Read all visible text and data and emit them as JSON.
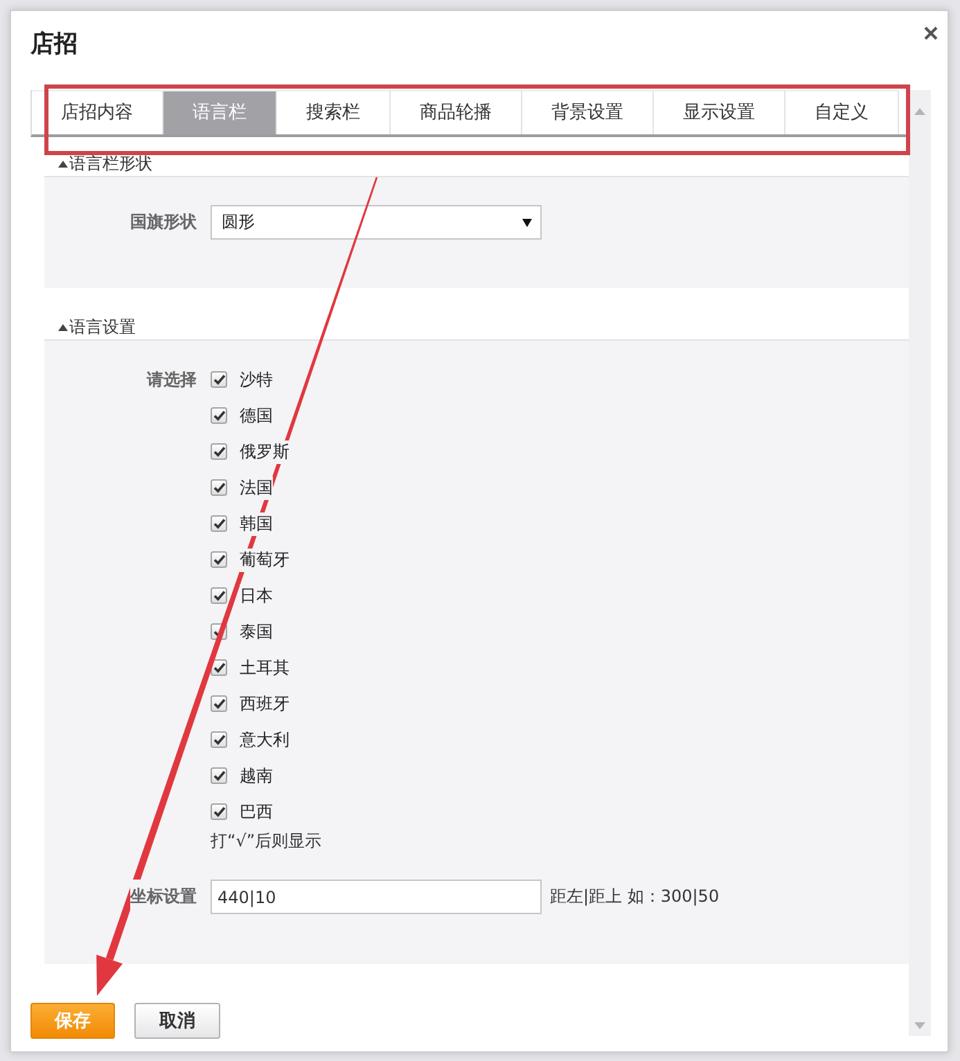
{
  "dialog": {
    "title": "店招"
  },
  "tabs": [
    {
      "label": "店招内容",
      "selected": false
    },
    {
      "label": "语言栏",
      "selected": true
    },
    {
      "label": "搜索栏",
      "selected": false
    },
    {
      "label": "商品轮播",
      "selected": false
    },
    {
      "label": "背景设置",
      "selected": false
    },
    {
      "label": "显示设置",
      "selected": false
    },
    {
      "label": "自定义",
      "selected": false
    }
  ],
  "sections": [
    {
      "title": "语言栏形状",
      "expanded": true,
      "fields": [
        {
          "kind": "select",
          "label": "国旗形状",
          "value": "圆形"
        }
      ]
    },
    {
      "title": "语言设置",
      "expanded": true,
      "fields": [
        {
          "kind": "checklist",
          "label": "请选择",
          "options": [
            {
              "label": "沙特",
              "checked": true
            },
            {
              "label": "德国",
              "checked": true
            },
            {
              "label": "俄罗斯",
              "checked": true
            },
            {
              "label": "法国",
              "checked": true
            },
            {
              "label": "韩国",
              "checked": true
            },
            {
              "label": "葡萄牙",
              "checked": true
            },
            {
              "label": "日本",
              "checked": true
            },
            {
              "label": "泰国",
              "checked": true
            },
            {
              "label": "土耳其",
              "checked": true
            },
            {
              "label": "西班牙",
              "checked": true
            },
            {
              "label": "意大利",
              "checked": true
            },
            {
              "label": "越南",
              "checked": true
            },
            {
              "label": "巴西",
              "checked": true
            }
          ],
          "note": "打“√”后则显示"
        },
        {
          "kind": "text",
          "label": "坐标设置",
          "value": "440|10",
          "hint": "距左|距上 如：300|50"
        }
      ]
    }
  ],
  "buttons": [
    {
      "label": "保存",
      "kind": "primary"
    },
    {
      "label": "取消",
      "kind": "secondary"
    }
  ]
}
